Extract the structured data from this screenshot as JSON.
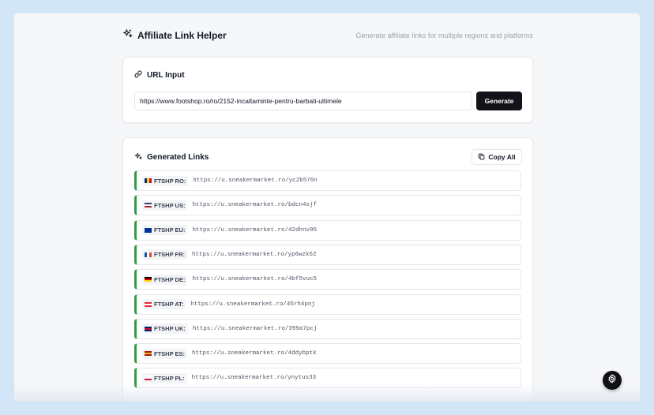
{
  "header": {
    "title": "Affiliate Link Helper",
    "subtitle": "Generate affiliate links for multiple regions and platforms",
    "icon": "sparkles-icon"
  },
  "url_section": {
    "title": "URL Input",
    "icon": "link-icon",
    "input_value": "https://www.footshop.ro/ro/2152-incaltaminte-pentru-barbati-ultimele",
    "generate_label": "Generate"
  },
  "links_section": {
    "title": "Generated Links",
    "icon": "sparkles-icon",
    "copy_all_label": "Copy All",
    "accent": "#2e9d47",
    "items": [
      {
        "label": "FTSHP RO:",
        "url": "https://u.sneakermarket.ro/yc2b576n",
        "flag": [
          "#002b7f",
          "#fcd116",
          "#ce1126"
        ],
        "flag_dir": "v"
      },
      {
        "label": "FTSHP US:",
        "url": "https://u.sneakermarket.ro/bdcn4sjf",
        "flag": [
          "#3c3b6e",
          "#ffffff",
          "#b22234"
        ],
        "flag_dir": "h"
      },
      {
        "label": "FTSHP EU:",
        "url": "https://u.sneakermarket.ro/42dhnv95",
        "flag": [
          "#003399",
          "#003399",
          "#003399"
        ],
        "flag_dir": "h"
      },
      {
        "label": "FTSHP FR:",
        "url": "https://u.sneakermarket.ro/yp6wzk62",
        "flag": [
          "#0055a4",
          "#ffffff",
          "#ef4135"
        ],
        "flag_dir": "v"
      },
      {
        "label": "FTSHP DE:",
        "url": "https://u.sneakermarket.ro/4bf5vuc5",
        "flag": [
          "#000000",
          "#dd0000",
          "#ffce00"
        ],
        "flag_dir": "h"
      },
      {
        "label": "FTSHP AT:",
        "url": "https://u.sneakermarket.ro/45rh4pnj",
        "flag": [
          "#ed2939",
          "#ffffff",
          "#ed2939"
        ],
        "flag_dir": "h"
      },
      {
        "label": "FTSHP UK:",
        "url": "https://u.sneakermarket.ro/399a7pcj",
        "flag": [
          "#012169",
          "#c8102e",
          "#012169"
        ],
        "flag_dir": "h"
      },
      {
        "label": "FTSHP ES:",
        "url": "https://u.sneakermarket.ro/4ddybptk",
        "flag": [
          "#aa151b",
          "#f1bf00",
          "#aa151b"
        ],
        "flag_dir": "h"
      },
      {
        "label": "FTSHP PL:",
        "url": "https://u.sneakermarket.ro/ynytus33",
        "flag": [
          "#ffffff",
          "#ffffff",
          "#dc143c"
        ],
        "flag_dir": "h"
      }
    ]
  },
  "fab": {
    "icon": "gear-icon"
  }
}
